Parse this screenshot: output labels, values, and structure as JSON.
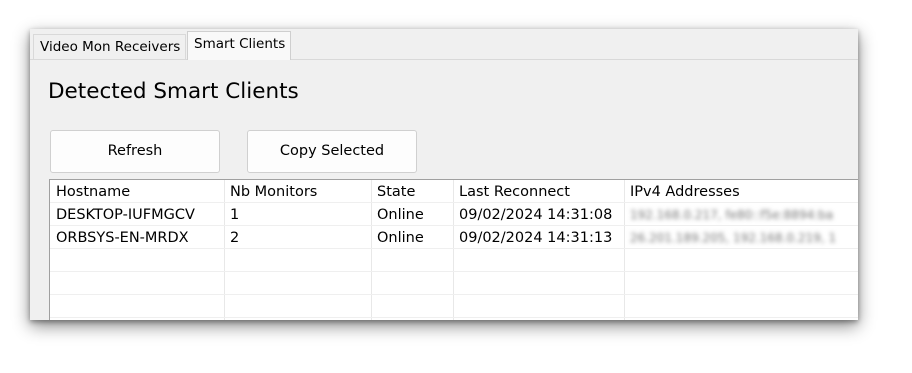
{
  "tabs": [
    {
      "label": "Video Mon Receivers",
      "active": false
    },
    {
      "label": "Smart Clients",
      "active": true
    }
  ],
  "page_title": "Detected Smart Clients",
  "buttons": {
    "refresh": "Refresh",
    "copy_selected": "Copy Selected"
  },
  "table": {
    "columns": [
      "Hostname",
      "Nb Monitors",
      "State",
      "Last Reconnect",
      "IPv4 Addresses"
    ],
    "rows": [
      {
        "hostname": "DESKTOP-IUFMGCV",
        "monitors": "1",
        "state": "Online",
        "last_reconnect": "09/02/2024 14:31:08",
        "ipv4": "192.168.0.217, fe80::f5e:8894:ba"
      },
      {
        "hostname": "ORBSYS-EN-MRDX",
        "monitors": "2",
        "state": "Online",
        "last_reconnect": "09/02/2024 14:31:13",
        "ipv4": "26.201.189.205, 192.168.0.219, 1"
      }
    ],
    "empty_rows": 3
  },
  "colors": {
    "window_bg": "#f0f0f0",
    "grid_bg": "#ffffff",
    "grid_border": "#a0a0a0",
    "button_bg": "#fdfdfd"
  }
}
